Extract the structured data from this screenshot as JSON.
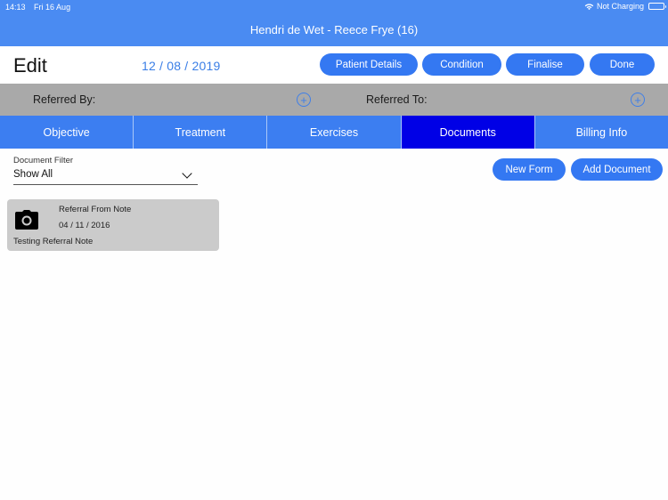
{
  "status_bar": {
    "time": "14:13",
    "date": "Fri 16 Aug",
    "charging_status": "Not Charging",
    "wifi_icon": "wifi-icon",
    "battery_icon": "battery-icon"
  },
  "nav": {
    "title": "Hendri de Wet - Reece Frye (16)"
  },
  "toolbar": {
    "title": "Edit",
    "date": "12 / 08 / 2019",
    "buttons": {
      "patient_details": "Patient Details",
      "condition": "Condition",
      "finalise": "Finalise",
      "done": "Done"
    }
  },
  "referral": {
    "referred_by_label": "Referred By:",
    "referred_to_label": "Referred To:",
    "add_icon": "plus-circle-icon"
  },
  "tabs": [
    {
      "label": "Objective",
      "active": false
    },
    {
      "label": "Treatment",
      "active": false
    },
    {
      "label": "Exercises",
      "active": false
    },
    {
      "label": "Documents",
      "active": true
    },
    {
      "label": "Billing Info",
      "active": false
    }
  ],
  "documents": {
    "filter_label": "Document Filter",
    "filter_value": "Show All",
    "new_form_label": "New Form",
    "add_document_label": "Add Document",
    "items": [
      {
        "icon": "camera-icon",
        "title": "Referral From Note",
        "date": "04 / 11 / 2016",
        "note": "Testing Referral Note"
      }
    ]
  },
  "colors": {
    "header_bg": "#4a8bf2",
    "button_bg": "#3478f2",
    "tab_bg": "#3c7ef1",
    "tab_active_bg": "#0000e6",
    "referral_bar_bg": "#a9a9a9",
    "card_bg": "#cbcbcb",
    "date_text": "#3a7ee6"
  }
}
